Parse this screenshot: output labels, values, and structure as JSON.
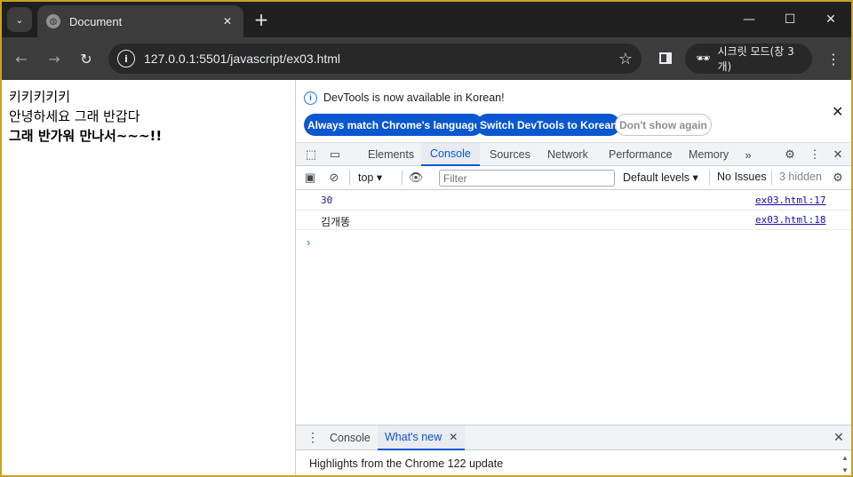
{
  "browser": {
    "tab_title": "Document",
    "url": "127.0.0.1:5501/javascript/ex03.html",
    "incognito_label": "시크릿 모드(창 3개)"
  },
  "page": {
    "line1": "키키키키키",
    "line2": "안녕하세요 그래 반갑다",
    "line3": "그래 반가워 만나서~~~!!"
  },
  "devtools": {
    "banner_message": "DevTools is now available in Korean!",
    "btn_match_language": "Always match Chrome's language",
    "btn_switch_korean": "Switch DevTools to Korean",
    "btn_dont_show": "Don't show again",
    "tabs": [
      "Elements",
      "Console",
      "Sources",
      "Network",
      "Performance",
      "Memory"
    ],
    "active_tab": "Console",
    "context": "top",
    "filter_placeholder": "Filter",
    "levels": "Default levels",
    "issues": "No Issues",
    "hidden": "3 hidden",
    "logs": [
      {
        "value": "30",
        "source": "ex03.html:17"
      },
      {
        "value": "김개똥",
        "source": "ex03.html:18"
      }
    ],
    "drawer": {
      "tab_console": "Console",
      "tab_whats_new": "What's new",
      "content": "Highlights from the Chrome 122 update"
    }
  },
  "colors": {
    "accent": "#0b57d0",
    "window_border": "#c9a227"
  }
}
